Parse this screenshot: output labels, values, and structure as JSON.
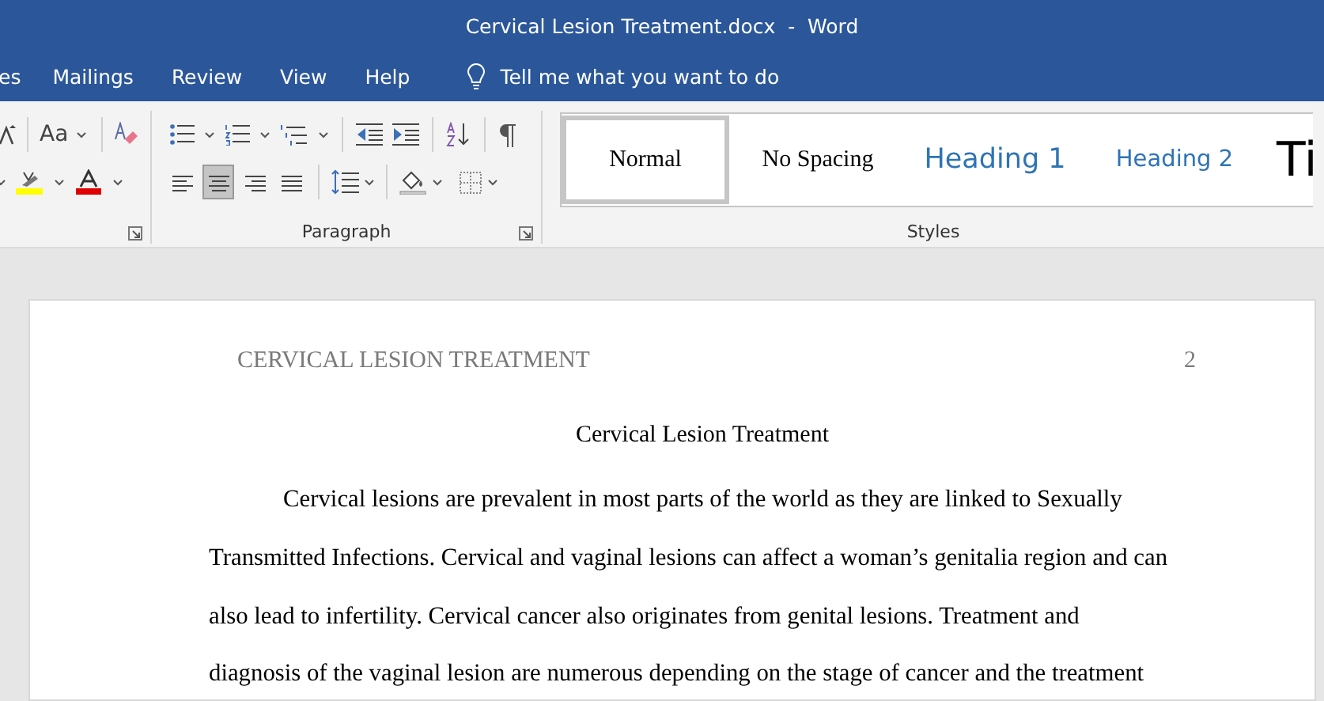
{
  "window": {
    "title": "Cervical Lesion Treatment.docx  -  Word"
  },
  "tabs": [
    {
      "label": "es",
      "selected": false
    },
    {
      "label": "Mailings",
      "selected": false
    },
    {
      "label": "Review",
      "selected": false
    },
    {
      "label": "View",
      "selected": false
    },
    {
      "label": "Help",
      "selected": false
    }
  ],
  "tell_me": {
    "placeholder": "Tell me what you want to do"
  },
  "ribbon": {
    "font_group": {
      "case_label": "Aa"
    },
    "paragraph_group": {
      "label": "Paragraph",
      "alignment": [
        {
          "kind": "left",
          "selected": false
        },
        {
          "kind": "center",
          "selected": true
        },
        {
          "kind": "right",
          "selected": false
        },
        {
          "kind": "justify",
          "selected": false
        }
      ]
    },
    "styles_group": {
      "label": "Styles",
      "styles": [
        {
          "label": "Normal",
          "kind": "normal",
          "selected": true
        },
        {
          "label": "No Spacing",
          "kind": "no_spacing",
          "selected": false
        },
        {
          "label": "Heading 1",
          "kind": "heading1",
          "selected": false
        },
        {
          "label": "Heading 2",
          "kind": "heading2",
          "selected": false
        },
        {
          "label": "Ti",
          "kind": "title",
          "selected": false
        }
      ]
    }
  },
  "document": {
    "header": "CERVICAL LESION TREATMENT",
    "page_number": "2",
    "title": "Cervical Lesion Treatment",
    "paragraph": "Cervical lesions are prevalent in most parts of the world as they are linked to Sexually Transmitted Infections. Cervical and vaginal lesions can affect a woman’s genitalia region and can also lead to infertility. Cervical cancer also originates from genital lesions. Treatment and diagnosis of the vaginal lesion are numerous depending on the stage of cancer and the treatment"
  }
}
